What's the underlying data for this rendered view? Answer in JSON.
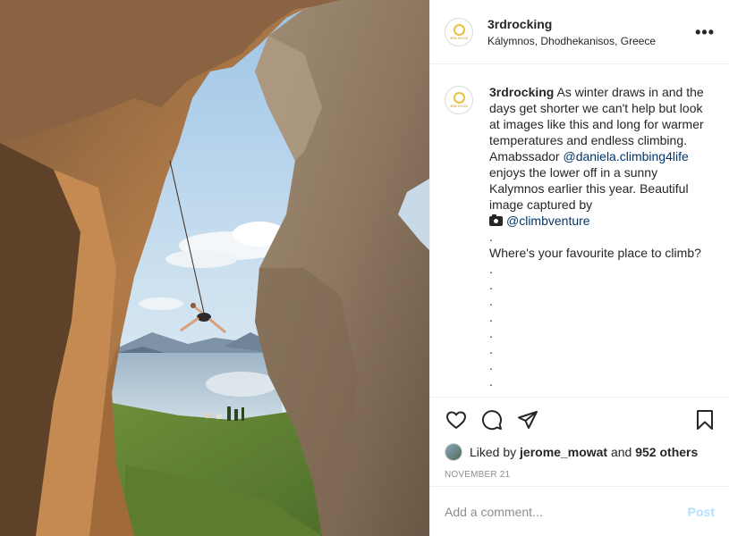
{
  "header": {
    "username": "3rdrocking",
    "location": "Kálymnos, Dhodhekanisos, Greece",
    "more_label": "•••",
    "avatar_logo_text": "3RD ROCK"
  },
  "caption": {
    "username": "3rdrocking",
    "text_1": "As winter draws in and the days get shorter we can't help but look at images like this and long for warmer temperatures and endless climbing. Amabssador",
    "mention_1": "@daniela.climbing4life",
    "text_2": "enjoys the lower off in a sunny Kalymnos earlier this year. Beautiful image captured by",
    "mention_2": "@climbventure",
    "dot_line": ".",
    "question": "Where's your favourite place to climb?",
    "trailing_dots": [
      ".",
      ".",
      ".",
      ".",
      ".",
      ".",
      ".",
      "."
    ]
  },
  "actions": {
    "like_icon": "heart-icon",
    "comment_icon": "comment-bubble-icon",
    "share_icon": "paper-plane-icon",
    "save_icon": "bookmark-icon"
  },
  "likes": {
    "prefix": "Liked by",
    "user": "jerome_mowat",
    "joiner": "and",
    "others": "952 others"
  },
  "date": "NOVEMBER 21",
  "comment": {
    "placeholder": "Add a comment...",
    "post_label": "Post"
  },
  "colors": {
    "text": "#262626",
    "secondary": "#8e8e8e",
    "link": "#00376b",
    "post_disabled": "#b2dffc",
    "divider": "#efefef"
  }
}
